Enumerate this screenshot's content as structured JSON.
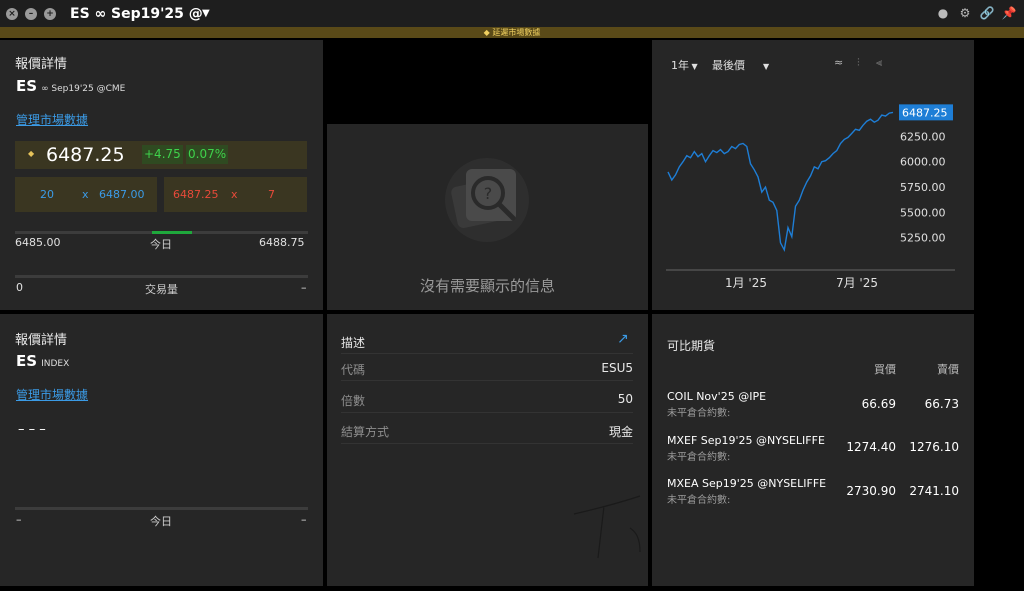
{
  "window": {
    "title": "ES ∞ Sep19'25 @CME",
    "controls": [
      "close",
      "minimize",
      "maximize"
    ],
    "toolbar_icons": [
      "people-icon",
      "gear-icon",
      "link-icon",
      "pin-icon"
    ]
  },
  "delay_banner": "延遲市場數據",
  "quote1": {
    "title": "報價詳情",
    "symbol": "ES",
    "symbol_sub": "∞ Sep19'25 @CME",
    "manage_link": "管理市場數據",
    "last": "6487.25",
    "change": "+4.75",
    "change_pct": "0.07%",
    "bid_size": "20",
    "bid_x": "x",
    "bid": "6487.00",
    "ask": "6487.25",
    "ask_x": "x",
    "ask_size": "7",
    "low": "6485.00",
    "range_label": "今日",
    "high": "6488.75",
    "volume_min": "0",
    "volume_label": "交易量",
    "volume_max": "–"
  },
  "quote2": {
    "title": "報價詳情",
    "symbol": "ES",
    "symbol_sub": "INDEX",
    "manage_link": "管理市場數據",
    "last": "–  –  –",
    "range_left": "–",
    "range_label": "今日",
    "range_right": "–"
  },
  "no_data": {
    "message": "沒有需要顯示的信息"
  },
  "description": {
    "title": "描述",
    "rows": [
      {
        "label": "代碼",
        "value": "ESU5"
      },
      {
        "label": "倍數",
        "value": "50"
      },
      {
        "label": "結算方式",
        "value": "現金"
      }
    ]
  },
  "chart": {
    "period": "1年",
    "mode": "最後價",
    "last_label": "6487.25",
    "y_ticks": [
      "6250.00",
      "6000.00",
      "5750.00",
      "5500.00",
      "5250.00"
    ],
    "x_ticks": [
      "1月 '25",
      "7月 '25"
    ],
    "accent": "#1e7ed6"
  },
  "chart_data": {
    "type": "line",
    "title": "",
    "xlabel": "",
    "ylabel": "",
    "ylim": [
      5000,
      6500
    ],
    "x_ticks": [
      "1月 '25",
      "7月 '25"
    ],
    "y": [
      5900,
      5820,
      5870,
      5950,
      6000,
      6060,
      6040,
      6100,
      6050,
      6080,
      6000,
      6060,
      6110,
      6090,
      6120,
      6080,
      6100,
      6150,
      6130,
      6170,
      6180,
      6150,
      5980,
      5920,
      5850,
      5700,
      5750,
      5620,
      5600,
      5520,
      5200,
      5130,
      5350,
      5260,
      5560,
      5620,
      5720,
      5800,
      5860,
      5950,
      5930,
      6000,
      6010,
      6040,
      6080,
      6110,
      6180,
      6220,
      6240,
      6280,
      6320,
      6310,
      6360,
      6400,
      6420,
      6390,
      6410,
      6460,
      6450,
      6480,
      6487.25
    ]
  },
  "futures": {
    "title": "可比期貨",
    "col_bid": "買價",
    "col_ask": "賣價",
    "rows": [
      {
        "name": "COIL Nov'25 @IPE",
        "sub": "未平倉合約數:",
        "bid": "66.69",
        "ask": "66.73"
      },
      {
        "name": "MXEF Sep19'25 @NYSELIFFE",
        "sub": "未平倉合約數:",
        "bid": "1274.40",
        "ask": "1276.10"
      },
      {
        "name": "MXEA Sep19'25 @NYSELIFFE",
        "sub": "未平倉合約數:",
        "bid": "2730.90",
        "ask": "2741.10"
      }
    ]
  }
}
